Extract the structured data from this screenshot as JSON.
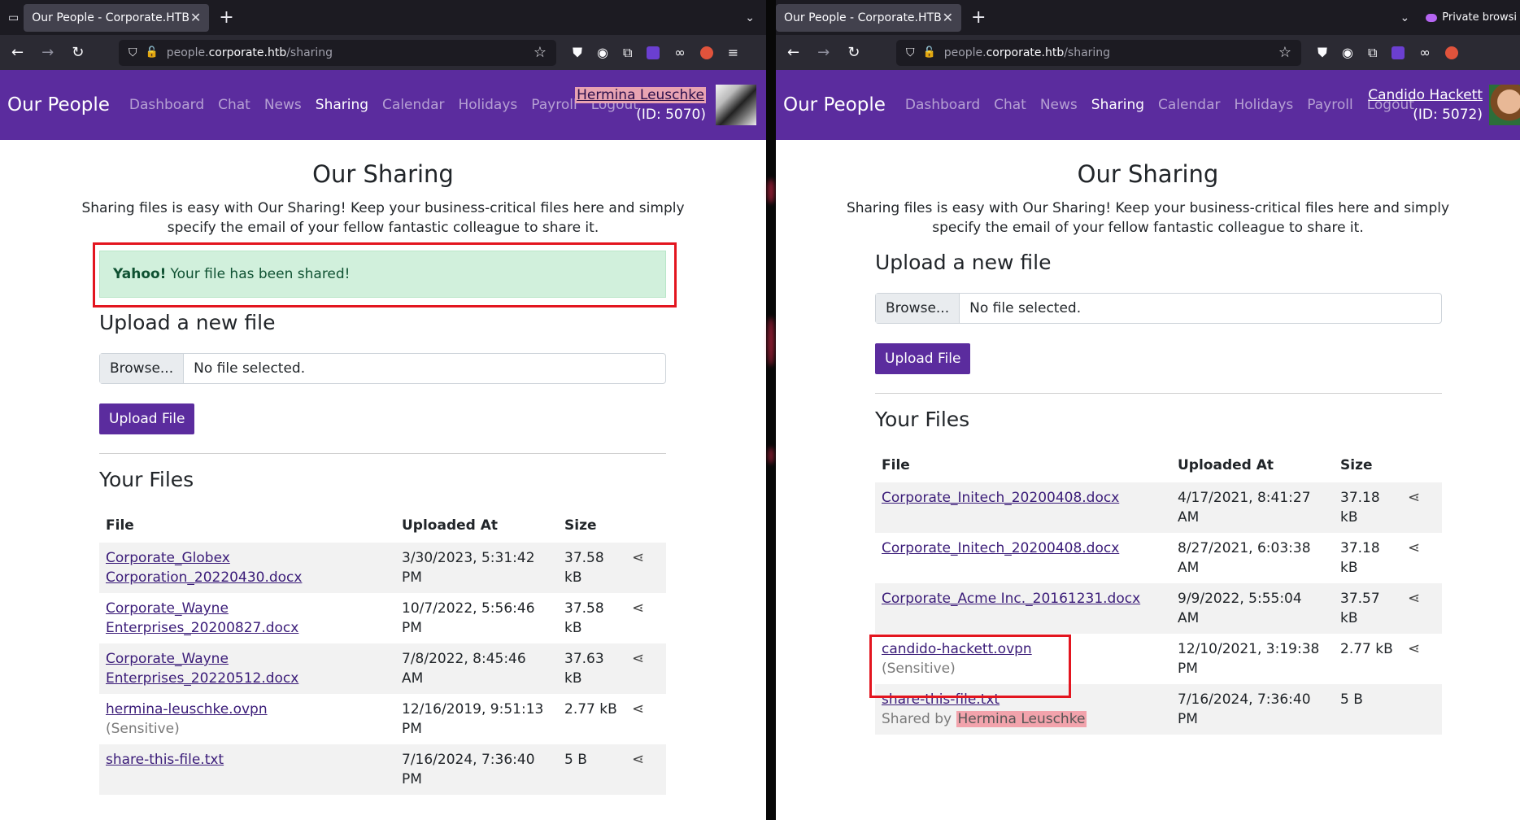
{
  "left": {
    "tab_title": "Our People - Corporate.HTB",
    "url_host_prefix": "people.",
    "url_host": "corporate.htb",
    "url_path": "/sharing",
    "brand": "Our People",
    "menu": [
      "Dashboard",
      "Chat",
      "News",
      "Sharing",
      "Calendar",
      "Holidays",
      "Payroll",
      "Logout"
    ],
    "active_menu": "Sharing",
    "user_name": "Hermina Leuschke",
    "user_id": "(ID: 5070)",
    "page_title": "Our Sharing",
    "lead_line1": "Sharing files is easy with Our Sharing! Keep your business-critical files here and simply",
    "lead_line2": "specify the email of your fellow fantastic colleague to share it.",
    "alert_strong": "Yahoo!",
    "alert_text": "Your file has been shared!",
    "upload_heading": "Upload a new file",
    "browse_label": "Browse...",
    "no_file": "No file selected.",
    "upload_button": "Upload File",
    "files_heading": "Your Files",
    "columns": [
      "File",
      "Uploaded At",
      "Size"
    ],
    "rows": [
      {
        "file_line1": "Corporate_Globex",
        "file_line2": "Corporation_20220430.docx",
        "note": "",
        "uploaded": "3/30/2023, 5:31:42 PM",
        "size": "37.58 kB"
      },
      {
        "file_line1": "Corporate_Wayne Enterprises_20200827.docx",
        "file_line2": "",
        "note": "",
        "uploaded": "10/7/2022, 5:56:46 PM",
        "size": "37.58 kB"
      },
      {
        "file_line1": "Corporate_Wayne Enterprises_20220512.docx",
        "file_line2": "",
        "note": "",
        "uploaded": "7/8/2022, 8:45:46 AM",
        "size": "37.63 kB"
      },
      {
        "file_line1": "hermina-leuschke.ovpn",
        "file_line2": "",
        "note": "(Sensitive)",
        "uploaded": "12/16/2019, 9:51:13 PM",
        "size": "2.77 kB"
      },
      {
        "file_line1": "share-this-file.txt",
        "file_line2": "",
        "note": "",
        "uploaded": "7/16/2024, 7:36:40 PM",
        "size": "5 B"
      }
    ]
  },
  "right": {
    "tab_title": "Our People - Corporate.HTB",
    "private_label": "Private browsi",
    "url_host_prefix": "people.",
    "url_host": "corporate.htb",
    "url_path": "/sharing",
    "brand": "Our People",
    "menu": [
      "Dashboard",
      "Chat",
      "News",
      "Sharing",
      "Calendar",
      "Holidays",
      "Payroll",
      "Logout"
    ],
    "active_menu": "Sharing",
    "user_name": "Candido Hackett",
    "user_id": "(ID: 5072)",
    "page_title": "Our Sharing",
    "lead_line1": "Sharing files is easy with Our Sharing! Keep your business-critical files here and simply",
    "lead_line2": "specify the email of your fellow fantastic colleague to share it.",
    "upload_heading": "Upload a new file",
    "browse_label": "Browse...",
    "no_file": "No file selected.",
    "upload_button": "Upload File",
    "files_heading": "Your Files",
    "columns": [
      "File",
      "Uploaded At",
      "Size"
    ],
    "rows": [
      {
        "file": "Corporate_Initech_20200408.docx",
        "note": "",
        "uploaded": "4/17/2021, 8:41:27 AM",
        "size": "37.18 kB"
      },
      {
        "file": "Corporate_Initech_20200408.docx",
        "note": "",
        "uploaded": "8/27/2021, 6:03:38 AM",
        "size": "37.18 kB"
      },
      {
        "file": "Corporate_Acme Inc._20161231.docx",
        "note": "",
        "uploaded": "9/9/2022, 5:55:04 AM",
        "size": "37.57 kB"
      },
      {
        "file": "candido-hackett.ovpn",
        "note": "(Sensitive)",
        "uploaded": "12/10/2021, 3:19:38 PM",
        "size": "2.77 kB"
      },
      {
        "file": "share-this-file.txt",
        "shared_by_label": "Shared by",
        "shared_by_name": "Hermina Leuschke",
        "uploaded": "7/16/2024, 7:36:40 PM",
        "size": "5 B"
      }
    ]
  },
  "colors": {
    "brand_purple": "#5b2c9e",
    "alert_green": "#d1f0dc",
    "highlight_red": "#e3151f"
  }
}
